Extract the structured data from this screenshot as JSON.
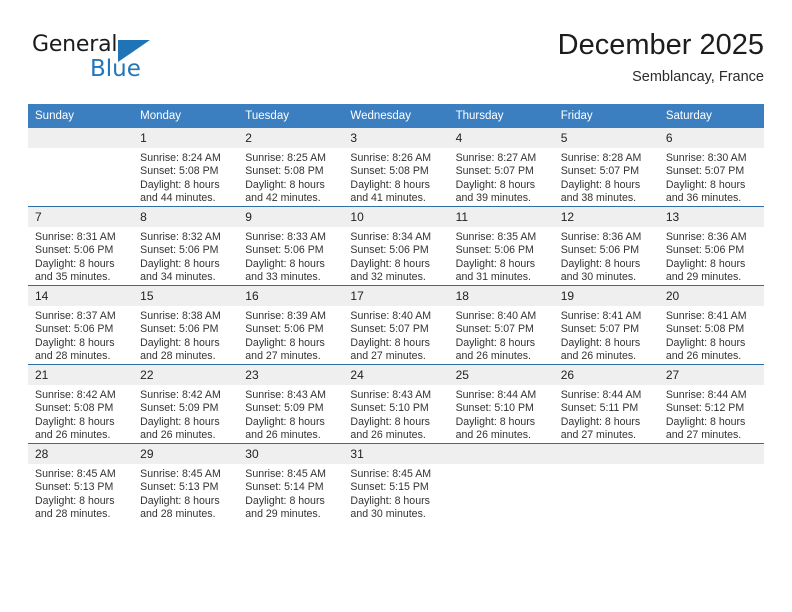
{
  "brand": {
    "name_top": "General",
    "name_bottom": "Blue",
    "accent_color": "#2277bb",
    "triangle_color": "#1f73b7"
  },
  "header": {
    "title": "December 2025",
    "subtitle": "Semblancay, France"
  },
  "theme": {
    "header_row_bg": "#3c7fc1",
    "daynum_bg": "#efefef",
    "row_border": "#2f6ea5"
  },
  "weekday_headers": [
    "Sunday",
    "Monday",
    "Tuesday",
    "Wednesday",
    "Thursday",
    "Friday",
    "Saturday"
  ],
  "weeks": [
    [
      {
        "day": "",
        "sunrise": "",
        "sunset": "",
        "daylight_line1": "",
        "daylight_line2": ""
      },
      {
        "day": "1",
        "sunrise": "Sunrise: 8:24 AM",
        "sunset": "Sunset: 5:08 PM",
        "daylight_line1": "Daylight: 8 hours",
        "daylight_line2": "and 44 minutes."
      },
      {
        "day": "2",
        "sunrise": "Sunrise: 8:25 AM",
        "sunset": "Sunset: 5:08 PM",
        "daylight_line1": "Daylight: 8 hours",
        "daylight_line2": "and 42 minutes."
      },
      {
        "day": "3",
        "sunrise": "Sunrise: 8:26 AM",
        "sunset": "Sunset: 5:08 PM",
        "daylight_line1": "Daylight: 8 hours",
        "daylight_line2": "and 41 minutes."
      },
      {
        "day": "4",
        "sunrise": "Sunrise: 8:27 AM",
        "sunset": "Sunset: 5:07 PM",
        "daylight_line1": "Daylight: 8 hours",
        "daylight_line2": "and 39 minutes."
      },
      {
        "day": "5",
        "sunrise": "Sunrise: 8:28 AM",
        "sunset": "Sunset: 5:07 PM",
        "daylight_line1": "Daylight: 8 hours",
        "daylight_line2": "and 38 minutes."
      },
      {
        "day": "6",
        "sunrise": "Sunrise: 8:30 AM",
        "sunset": "Sunset: 5:07 PM",
        "daylight_line1": "Daylight: 8 hours",
        "daylight_line2": "and 36 minutes."
      }
    ],
    [
      {
        "day": "7",
        "sunrise": "Sunrise: 8:31 AM",
        "sunset": "Sunset: 5:06 PM",
        "daylight_line1": "Daylight: 8 hours",
        "daylight_line2": "and 35 minutes."
      },
      {
        "day": "8",
        "sunrise": "Sunrise: 8:32 AM",
        "sunset": "Sunset: 5:06 PM",
        "daylight_line1": "Daylight: 8 hours",
        "daylight_line2": "and 34 minutes."
      },
      {
        "day": "9",
        "sunrise": "Sunrise: 8:33 AM",
        "sunset": "Sunset: 5:06 PM",
        "daylight_line1": "Daylight: 8 hours",
        "daylight_line2": "and 33 minutes."
      },
      {
        "day": "10",
        "sunrise": "Sunrise: 8:34 AM",
        "sunset": "Sunset: 5:06 PM",
        "daylight_line1": "Daylight: 8 hours",
        "daylight_line2": "and 32 minutes."
      },
      {
        "day": "11",
        "sunrise": "Sunrise: 8:35 AM",
        "sunset": "Sunset: 5:06 PM",
        "daylight_line1": "Daylight: 8 hours",
        "daylight_line2": "and 31 minutes."
      },
      {
        "day": "12",
        "sunrise": "Sunrise: 8:36 AM",
        "sunset": "Sunset: 5:06 PM",
        "daylight_line1": "Daylight: 8 hours",
        "daylight_line2": "and 30 minutes."
      },
      {
        "day": "13",
        "sunrise": "Sunrise: 8:36 AM",
        "sunset": "Sunset: 5:06 PM",
        "daylight_line1": "Daylight: 8 hours",
        "daylight_line2": "and 29 minutes."
      }
    ],
    [
      {
        "day": "14",
        "sunrise": "Sunrise: 8:37 AM",
        "sunset": "Sunset: 5:06 PM",
        "daylight_line1": "Daylight: 8 hours",
        "daylight_line2": "and 28 minutes."
      },
      {
        "day": "15",
        "sunrise": "Sunrise: 8:38 AM",
        "sunset": "Sunset: 5:06 PM",
        "daylight_line1": "Daylight: 8 hours",
        "daylight_line2": "and 28 minutes."
      },
      {
        "day": "16",
        "sunrise": "Sunrise: 8:39 AM",
        "sunset": "Sunset: 5:06 PM",
        "daylight_line1": "Daylight: 8 hours",
        "daylight_line2": "and 27 minutes."
      },
      {
        "day": "17",
        "sunrise": "Sunrise: 8:40 AM",
        "sunset": "Sunset: 5:07 PM",
        "daylight_line1": "Daylight: 8 hours",
        "daylight_line2": "and 27 minutes."
      },
      {
        "day": "18",
        "sunrise": "Sunrise: 8:40 AM",
        "sunset": "Sunset: 5:07 PM",
        "daylight_line1": "Daylight: 8 hours",
        "daylight_line2": "and 26 minutes."
      },
      {
        "day": "19",
        "sunrise": "Sunrise: 8:41 AM",
        "sunset": "Sunset: 5:07 PM",
        "daylight_line1": "Daylight: 8 hours",
        "daylight_line2": "and 26 minutes."
      },
      {
        "day": "20",
        "sunrise": "Sunrise: 8:41 AM",
        "sunset": "Sunset: 5:08 PM",
        "daylight_line1": "Daylight: 8 hours",
        "daylight_line2": "and 26 minutes."
      }
    ],
    [
      {
        "day": "21",
        "sunrise": "Sunrise: 8:42 AM",
        "sunset": "Sunset: 5:08 PM",
        "daylight_line1": "Daylight: 8 hours",
        "daylight_line2": "and 26 minutes."
      },
      {
        "day": "22",
        "sunrise": "Sunrise: 8:42 AM",
        "sunset": "Sunset: 5:09 PM",
        "daylight_line1": "Daylight: 8 hours",
        "daylight_line2": "and 26 minutes."
      },
      {
        "day": "23",
        "sunrise": "Sunrise: 8:43 AM",
        "sunset": "Sunset: 5:09 PM",
        "daylight_line1": "Daylight: 8 hours",
        "daylight_line2": "and 26 minutes."
      },
      {
        "day": "24",
        "sunrise": "Sunrise: 8:43 AM",
        "sunset": "Sunset: 5:10 PM",
        "daylight_line1": "Daylight: 8 hours",
        "daylight_line2": "and 26 minutes."
      },
      {
        "day": "25",
        "sunrise": "Sunrise: 8:44 AM",
        "sunset": "Sunset: 5:10 PM",
        "daylight_line1": "Daylight: 8 hours",
        "daylight_line2": "and 26 minutes."
      },
      {
        "day": "26",
        "sunrise": "Sunrise: 8:44 AM",
        "sunset": "Sunset: 5:11 PM",
        "daylight_line1": "Daylight: 8 hours",
        "daylight_line2": "and 27 minutes."
      },
      {
        "day": "27",
        "sunrise": "Sunrise: 8:44 AM",
        "sunset": "Sunset: 5:12 PM",
        "daylight_line1": "Daylight: 8 hours",
        "daylight_line2": "and 27 minutes."
      }
    ],
    [
      {
        "day": "28",
        "sunrise": "Sunrise: 8:45 AM",
        "sunset": "Sunset: 5:13 PM",
        "daylight_line1": "Daylight: 8 hours",
        "daylight_line2": "and 28 minutes."
      },
      {
        "day": "29",
        "sunrise": "Sunrise: 8:45 AM",
        "sunset": "Sunset: 5:13 PM",
        "daylight_line1": "Daylight: 8 hours",
        "daylight_line2": "and 28 minutes."
      },
      {
        "day": "30",
        "sunrise": "Sunrise: 8:45 AM",
        "sunset": "Sunset: 5:14 PM",
        "daylight_line1": "Daylight: 8 hours",
        "daylight_line2": "and 29 minutes."
      },
      {
        "day": "31",
        "sunrise": "Sunrise: 8:45 AM",
        "sunset": "Sunset: 5:15 PM",
        "daylight_line1": "Daylight: 8 hours",
        "daylight_line2": "and 30 minutes."
      },
      {
        "day": "",
        "sunrise": "",
        "sunset": "",
        "daylight_line1": "",
        "daylight_line2": ""
      },
      {
        "day": "",
        "sunrise": "",
        "sunset": "",
        "daylight_line1": "",
        "daylight_line2": ""
      },
      {
        "day": "",
        "sunrise": "",
        "sunset": "",
        "daylight_line1": "",
        "daylight_line2": ""
      }
    ]
  ]
}
